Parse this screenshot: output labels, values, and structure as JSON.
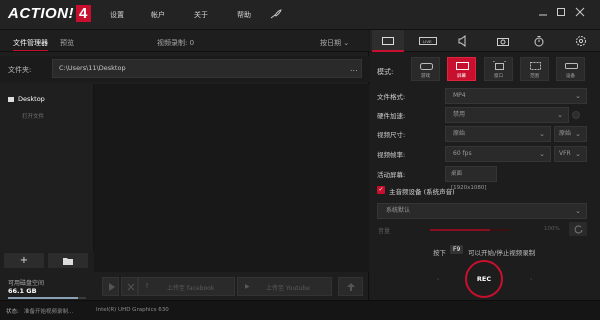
{
  "app": {
    "logo_text": "ACTION!",
    "logo_version": "4"
  },
  "menu": {
    "settings": "设置",
    "account": "帐户",
    "about": "关于",
    "help": "帮助"
  },
  "left": {
    "tabs": {
      "files": "文件管理器",
      "preview": "预览"
    },
    "video_count": "视频录制: 0",
    "sort": "按日期",
    "folder_label": "文件夹:",
    "folder_path": "C:\\Users\\11\\Desktop",
    "folder_more": "...",
    "tree": {
      "root": "Desktop",
      "open_folder": "打开文件"
    },
    "add_label": "+",
    "disk": {
      "label": "可用磁盘空间",
      "value": "66.1 GB",
      "used_fraction": 0.9
    },
    "upload": {
      "facebook": "上传至 facebook",
      "youtube": "上传至 Youtube"
    }
  },
  "status": {
    "label": "状态:",
    "text": "准备开始视频录制...",
    "gpu": "Intel(R) UHD Graphics 630"
  },
  "right": {
    "mode_label": "模式:",
    "modes": [
      "游戏",
      "屏幕",
      "窗口",
      "范围",
      "设备"
    ],
    "fields": {
      "format": {
        "label": "文件格式:",
        "value": "MP4"
      },
      "hwaccel": {
        "label": "硬件加速:",
        "value": "禁用"
      },
      "size": {
        "label": "视频尺寸:",
        "value": "原始",
        "value2": "原始"
      },
      "fps": {
        "label": "视频帧率:",
        "value": "60 fps",
        "mode": "VFR"
      },
      "screen": {
        "label": "活动屏幕:",
        "value": "桌面 [1920x1080]"
      }
    },
    "audio": {
      "label": "主音频设备 (系统声音)",
      "device": "系统默认",
      "volume_label": "音量",
      "volume_pct": "100%",
      "volume_fraction": 0.75
    },
    "hint": {
      "pre": "按下",
      "key": "F9",
      "post": "可以开始/停止视频录制"
    },
    "rec_label": "REC",
    "colors": {
      "accent": "#c8102e"
    }
  }
}
